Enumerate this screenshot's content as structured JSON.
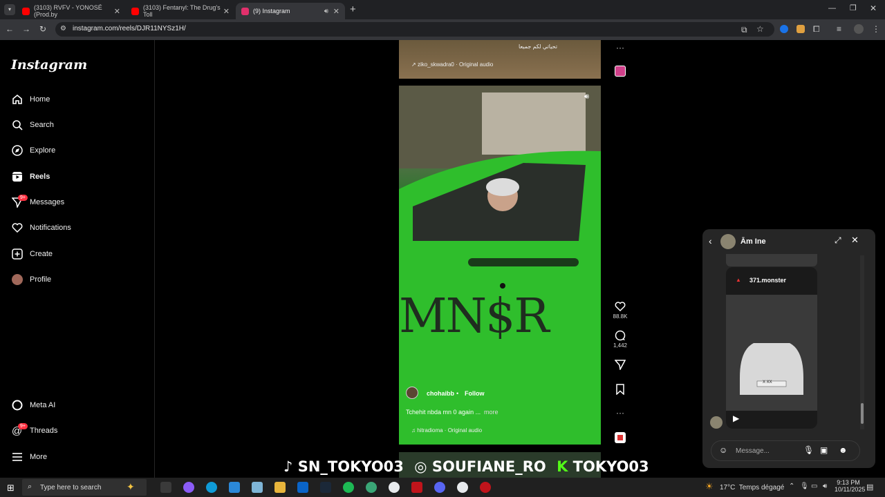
{
  "browser": {
    "tabs": [
      {
        "title": "(3103) RVFV - YONOSÉ (Prod.by",
        "color": "#ff0000"
      },
      {
        "title": "(3103) Fentanyl: The Drug's Toll",
        "color": "#ff0000"
      },
      {
        "title": "(9) Instagram",
        "color": "#e1306c"
      }
    ],
    "new_tab": "+",
    "url": "instagram.com/reels/DJR11NYSz1H/"
  },
  "sidebar": {
    "logo": "Instagram",
    "items": [
      {
        "label": "Home",
        "icon": "home-icon"
      },
      {
        "label": "Search",
        "icon": "search-icon"
      },
      {
        "label": "Explore",
        "icon": "compass-icon"
      },
      {
        "label": "Reels",
        "icon": "reels-icon"
      },
      {
        "label": "Messages",
        "icon": "messenger-icon"
      },
      {
        "label": "Notifications",
        "icon": "heart-icon"
      },
      {
        "label": "Create",
        "icon": "plus-square-icon"
      },
      {
        "label": "Profile",
        "icon": "avatar"
      }
    ],
    "messages_badge": "9+",
    "threads_badge": "9+",
    "bottom_items": [
      {
        "label": "Meta AI",
        "icon": "meta-ai-icon"
      },
      {
        "label": "Threads",
        "icon": "threads-icon"
      },
      {
        "label": "More",
        "icon": "menu-icon"
      }
    ]
  },
  "reels": {
    "prev_caption": "تحياتي لكم جميعا",
    "prev_audio": "ziko_skwadra0 · Original audio",
    "username": "chohaibb",
    "dot": "•",
    "follow": "Follow",
    "caption": "Tchehit nbda mn 0 again ...",
    "more": "more",
    "audio": "hitradioma · Original audio",
    "car_text": "MN$R",
    "likes": "88.8K",
    "comments": "1,442"
  },
  "chat": {
    "name": "Ām Ine",
    "shared_user": "371.monster",
    "plate": "X  XX",
    "message_placeholder": "Message..."
  },
  "watermark": {
    "tiktok": "SN_TOKYO03",
    "instagram": "SOUFIANE_RO",
    "kick": "TOKYO03"
  },
  "taskbar": {
    "search_placeholder": "Type here to search",
    "weather": "17°C  Temps dégagé",
    "time": "9:13 PM",
    "date": "10/11/2025"
  }
}
